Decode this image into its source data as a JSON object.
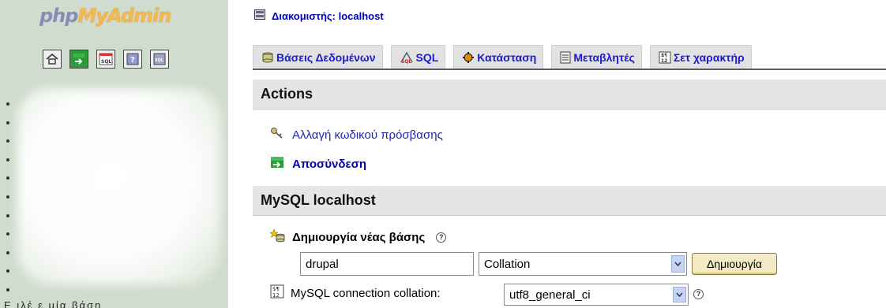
{
  "left": {
    "logo": {
      "php": "php",
      "my": "My",
      "admin": "Admin"
    },
    "icons": [
      "home-icon",
      "exit-icon",
      "sql-query-icon",
      "help-icon",
      "sql-docs-icon"
    ],
    "db_count": 11,
    "footer_text": "Ε     ιλέ     ε μία βάση"
  },
  "right": {
    "server_label": "Διακομιστής: localhost",
    "tabs": [
      {
        "label": "Βάσεις Δεδομένων",
        "icon": "databases-icon"
      },
      {
        "label": "SQL",
        "icon": "sql-icon"
      },
      {
        "label": "Κατάσταση",
        "icon": "status-icon"
      },
      {
        "label": "Μεταβλητές",
        "icon": "variables-icon"
      },
      {
        "label": "Σετ χαρακτήρ",
        "icon": "charset-icon"
      }
    ],
    "actions": {
      "title": "Actions",
      "change_password": "Αλλαγή κωδικού πρόσβασης",
      "logout": "Αποσύνδεση"
    },
    "mysql": {
      "title": "MySQL localhost",
      "create_db_label": "Δημιουργία νέας βάσης",
      "db_name_value": "drupal",
      "collation_placeholder": "Collation",
      "create_button": "Δημιουργία",
      "connection_collation_label": "MySQL connection collation:",
      "connection_collation_value": "utf8_general_ci"
    }
  },
  "colors": {
    "left_bg": "#d0dccd",
    "link_blue": "#2323b7",
    "header_gray": "#e5e5e5",
    "tab_gray": "#e2e2e2",
    "button_bg": "#f4eac6"
  }
}
